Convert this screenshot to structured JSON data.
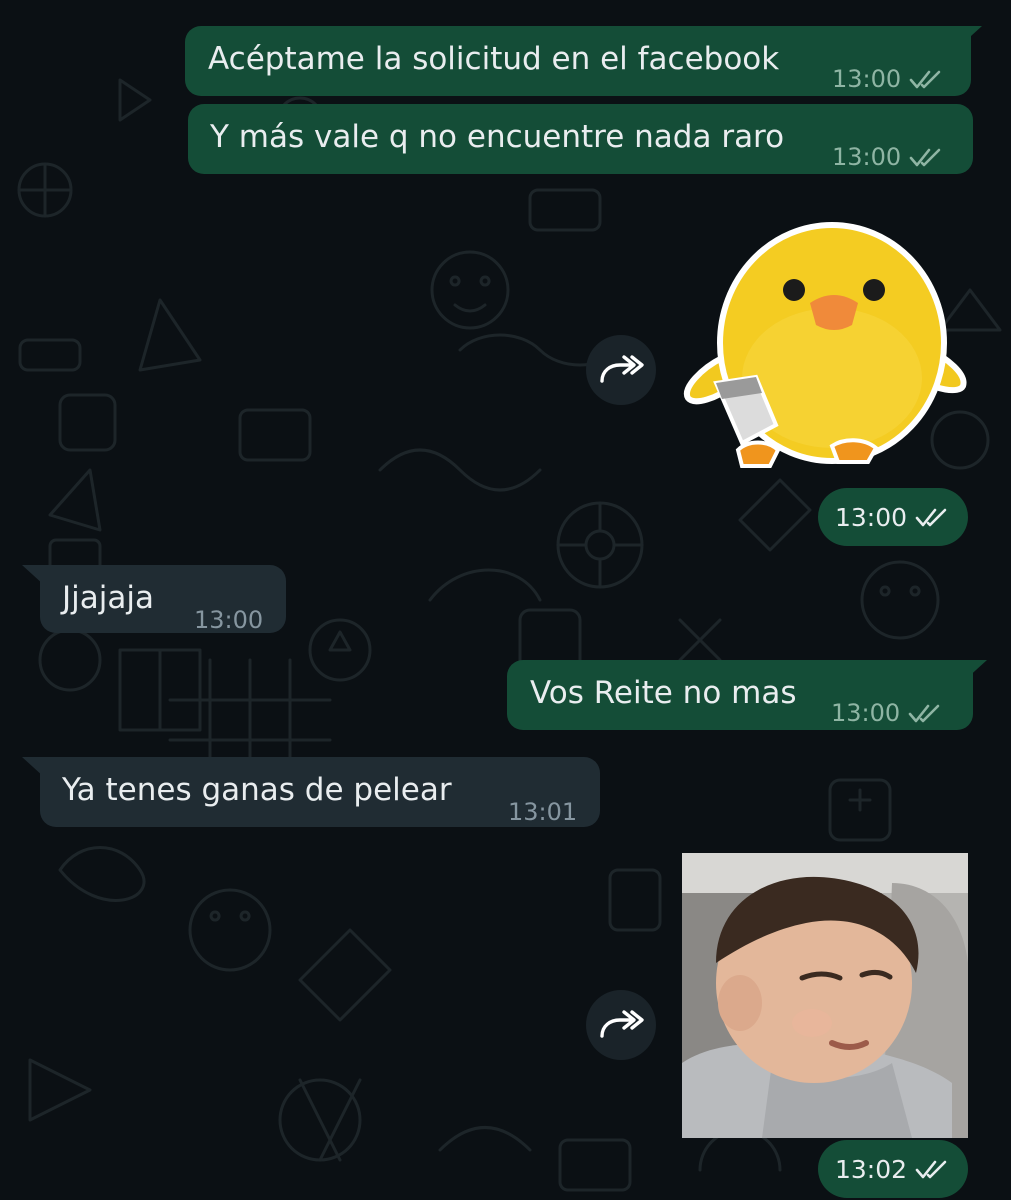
{
  "chat": {
    "messages": [
      {
        "direction": "outgoing",
        "text": "Acéptame la solicitud en el facebook",
        "time": "13:00",
        "status": "read"
      },
      {
        "direction": "outgoing",
        "text": "Y más vale q no encuentre nada raro",
        "time": "13:00",
        "status": "read"
      },
      {
        "direction": "outgoing",
        "type": "sticker",
        "sticker": "yellow-chick-plush-with-knife",
        "time": "13:00",
        "status": "read"
      },
      {
        "direction": "incoming",
        "text": "Jjajaja",
        "time": "13:00"
      },
      {
        "direction": "outgoing",
        "text": "Vos Reite no mas",
        "time": "13:00",
        "status": "read"
      },
      {
        "direction": "incoming",
        "text": "Ya tenes ganas de pelear",
        "time": "13:01"
      },
      {
        "direction": "outgoing",
        "type": "photo",
        "photo": "toddler-squinting-on-sofa",
        "time": "13:02",
        "status": "read"
      }
    ]
  },
  "colors": {
    "background": "#0b1014",
    "outgoing_bubble": "#144d37",
    "incoming_bubble": "#202c33",
    "text": "#e9edef",
    "meta_outgoing": "#8fb5a4",
    "meta_incoming": "#8696a0"
  },
  "icons": {
    "read_receipt": "double-check-icon",
    "forward": "forward-icon"
  }
}
